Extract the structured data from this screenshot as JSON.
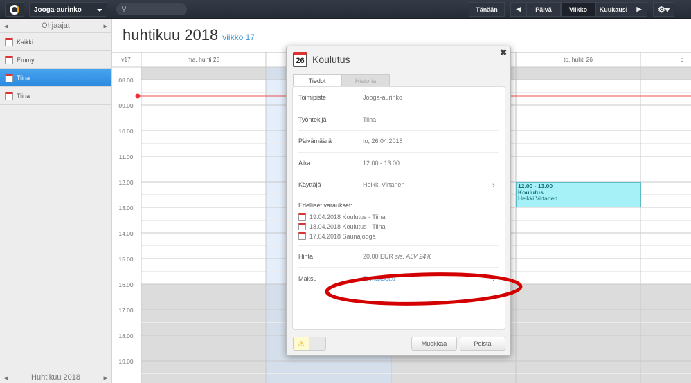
{
  "topbar": {
    "location": "Jooga-aurinko",
    "today": "Tänään",
    "day": "Päivä",
    "week": "Viikko",
    "month": "Kuukausi"
  },
  "sidebar": {
    "header": "Ohjaajat",
    "items": [
      {
        "label": "Kaikki"
      },
      {
        "label": "Emmy"
      },
      {
        "label": "Tiina",
        "selected": true
      },
      {
        "label": "Tiina"
      }
    ],
    "footer": "Huhtikuu 2018"
  },
  "main": {
    "title": "huhtikuu 2018",
    "week": "viikko 17",
    "week_short": "v17",
    "days": [
      "ma, huhti 23",
      "",
      "",
      "to, huhti 26",
      "p"
    ],
    "hours": [
      "08.00",
      "09.00",
      "10.00",
      "11.00",
      "12.00",
      "13.00",
      "14.00",
      "15.00",
      "16.00",
      "17.00",
      "18.00",
      "19.00"
    ]
  },
  "event": {
    "time": "12.00 - 13.00",
    "title": "Koulutus",
    "customer": "Heikki Virtanen"
  },
  "modal": {
    "calendar_day": "26",
    "title": "Koulutus",
    "tabs": [
      "Tiedot",
      "Historia"
    ],
    "rows": [
      {
        "k": "Toimipiste",
        "v": "Jooga-aurinko"
      },
      {
        "k": "Työntekijä",
        "v": "Tiina"
      },
      {
        "k": "Päivämäärä",
        "v": "to, 26.04.2018"
      },
      {
        "k": "Aika",
        "v": "12.00 - 13.00"
      },
      {
        "k": "Käyttäjä",
        "v": "Heikki Virtanen"
      }
    ],
    "previous_label": "Edelliset varaukset:",
    "previous": [
      "19.04.2018 Koulutus - Tiina",
      "18.04.2018 Koulutus - Tiina",
      "17.04.2018 Saunajooga"
    ],
    "price_label": "Hinta",
    "price": "20,00 EUR",
    "vat": "sis. ALV 24%",
    "payment_label": "Maksu",
    "payment": "Ei maksettu",
    "edit": "Muokkaa",
    "delete": "Poista"
  },
  "colors": {
    "accent": "#3a95d6",
    "highlight": "#e00000"
  }
}
